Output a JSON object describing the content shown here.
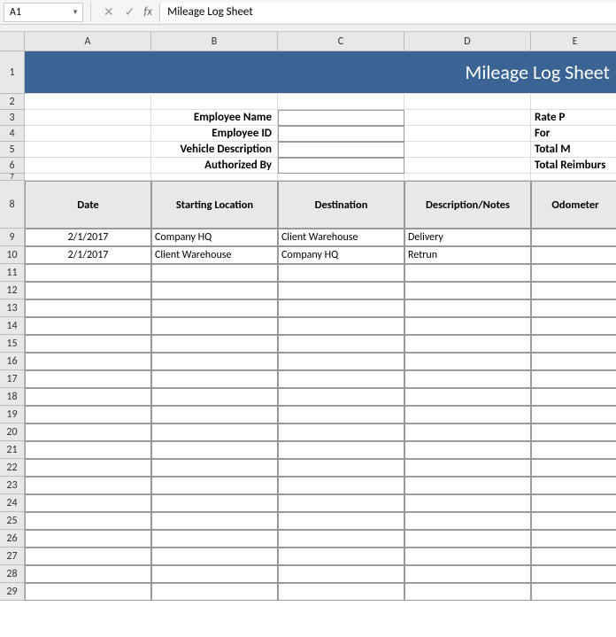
{
  "formula_bar": {
    "cell_ref": "A1",
    "formula_value": "Mileage Log Sheet"
  },
  "columns": [
    "A",
    "B",
    "C",
    "D",
    "E"
  ],
  "title": "Mileage Log Sheet",
  "form_labels": {
    "emp_name": "Employee Name",
    "emp_id": "Employee ID",
    "vehicle": "Vehicle Description",
    "auth": "Authorized By"
  },
  "right_labels": {
    "rate": "Rate P",
    "for": "For",
    "total_m": "Total M",
    "reimburse": "Total Reimburs"
  },
  "headers": {
    "date": "Date",
    "start": "Starting Location",
    "dest": "Destination",
    "desc": "Description/Notes",
    "odo": "Odometer"
  },
  "rows": [
    {
      "date": "2/1/2017",
      "start": "Company HQ",
      "dest": "Client Warehouse",
      "desc": "Delivery",
      "odo": ""
    },
    {
      "date": "2/1/2017",
      "start": "Client Warehouse",
      "dest": "Company HQ",
      "desc": "Retrun",
      "odo": ""
    },
    {
      "date": "",
      "start": "",
      "dest": "",
      "desc": "",
      "odo": ""
    },
    {
      "date": "",
      "start": "",
      "dest": "",
      "desc": "",
      "odo": ""
    },
    {
      "date": "",
      "start": "",
      "dest": "",
      "desc": "",
      "odo": ""
    },
    {
      "date": "",
      "start": "",
      "dest": "",
      "desc": "",
      "odo": ""
    },
    {
      "date": "",
      "start": "",
      "dest": "",
      "desc": "",
      "odo": ""
    },
    {
      "date": "",
      "start": "",
      "dest": "",
      "desc": "",
      "odo": ""
    },
    {
      "date": "",
      "start": "",
      "dest": "",
      "desc": "",
      "odo": ""
    },
    {
      "date": "",
      "start": "",
      "dest": "",
      "desc": "",
      "odo": ""
    },
    {
      "date": "",
      "start": "",
      "dest": "",
      "desc": "",
      "odo": ""
    },
    {
      "date": "",
      "start": "",
      "dest": "",
      "desc": "",
      "odo": ""
    },
    {
      "date": "",
      "start": "",
      "dest": "",
      "desc": "",
      "odo": ""
    },
    {
      "date": "",
      "start": "",
      "dest": "",
      "desc": "",
      "odo": ""
    },
    {
      "date": "",
      "start": "",
      "dest": "",
      "desc": "",
      "odo": ""
    },
    {
      "date": "",
      "start": "",
      "dest": "",
      "desc": "",
      "odo": ""
    },
    {
      "date": "",
      "start": "",
      "dest": "",
      "desc": "",
      "odo": ""
    },
    {
      "date": "",
      "start": "",
      "dest": "",
      "desc": "",
      "odo": ""
    },
    {
      "date": "",
      "start": "",
      "dest": "",
      "desc": "",
      "odo": ""
    },
    {
      "date": "",
      "start": "",
      "dest": "",
      "desc": "",
      "odo": ""
    },
    {
      "date": "",
      "start": "",
      "dest": "",
      "desc": "",
      "odo": ""
    }
  ],
  "row_count": 29
}
